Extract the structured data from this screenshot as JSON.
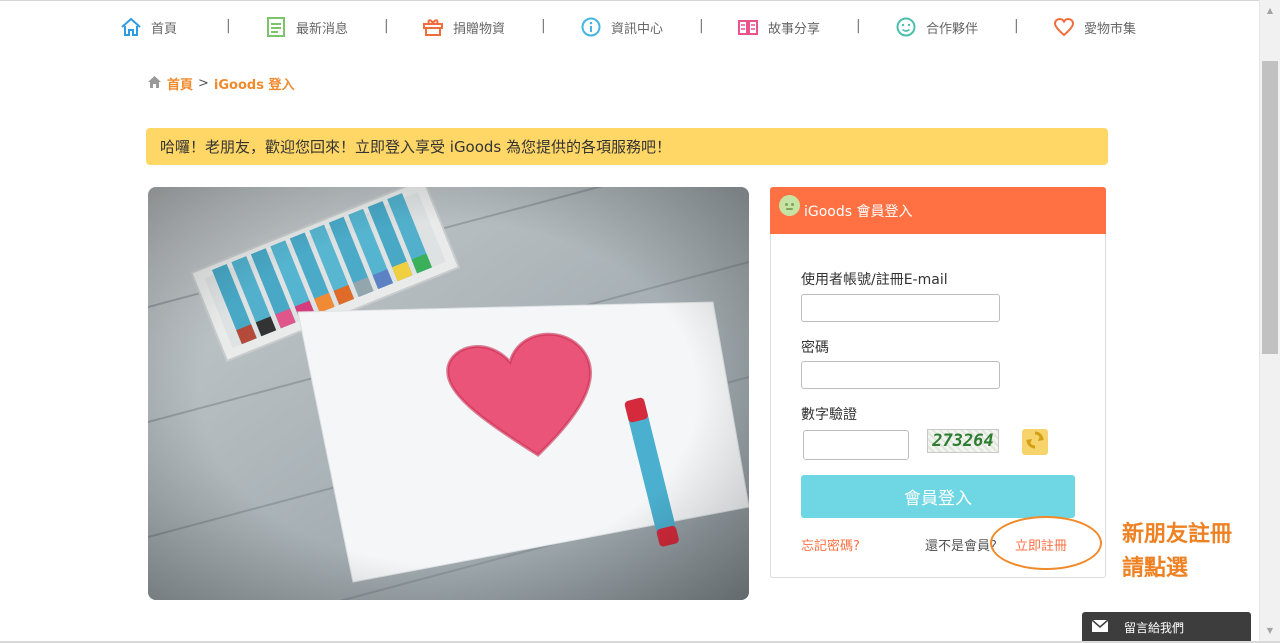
{
  "nav": {
    "items": [
      {
        "label": "首頁",
        "icon": "home-icon",
        "color": "#2f9be3"
      },
      {
        "label": "最新消息",
        "icon": "news-icon",
        "color": "#7cc36b"
      },
      {
        "label": "捐贈物資",
        "icon": "donate-box-icon",
        "color": "#ef6c3d"
      },
      {
        "label": "資訊中心",
        "icon": "info-icon",
        "color": "#43b6e0"
      },
      {
        "label": "故事分享",
        "icon": "book-icon",
        "color": "#e9528a"
      },
      {
        "label": "合作夥伴",
        "icon": "smile-icon",
        "color": "#4bbfae"
      },
      {
        "label": "愛物市集",
        "icon": "heart-icon",
        "color": "#ef6c3d"
      }
    ],
    "separator": "|"
  },
  "breadcrumb": {
    "home": "首頁",
    "separator": ">",
    "current": "iGoods 登入"
  },
  "banner": {
    "text": "哈囉！老朋友，歡迎您回來！立即登入享受 iGoods 為您提供的各項服務吧！"
  },
  "login": {
    "title": "iGoods 會員登入",
    "username_label": "使用者帳號/註冊E-mail",
    "username_value": "",
    "password_label": "密碼",
    "password_value": "",
    "captcha_label": "數字驗證",
    "captcha_value": "",
    "captcha_code": "273264",
    "submit_label": "會員登入",
    "forgot_label": "忘記密碼?",
    "not_member_label": "還不是會員？",
    "register_label": "立即註冊"
  },
  "annotation": {
    "line1": "新朋友註冊",
    "line2": "請點選"
  },
  "message_widget": {
    "label": "留言給我們"
  },
  "colors": {
    "accent_orange": "#ff7043",
    "banner_yellow": "#ffd766",
    "button_cyan": "#6fd6e3",
    "annotation_orange": "#ee8123"
  }
}
